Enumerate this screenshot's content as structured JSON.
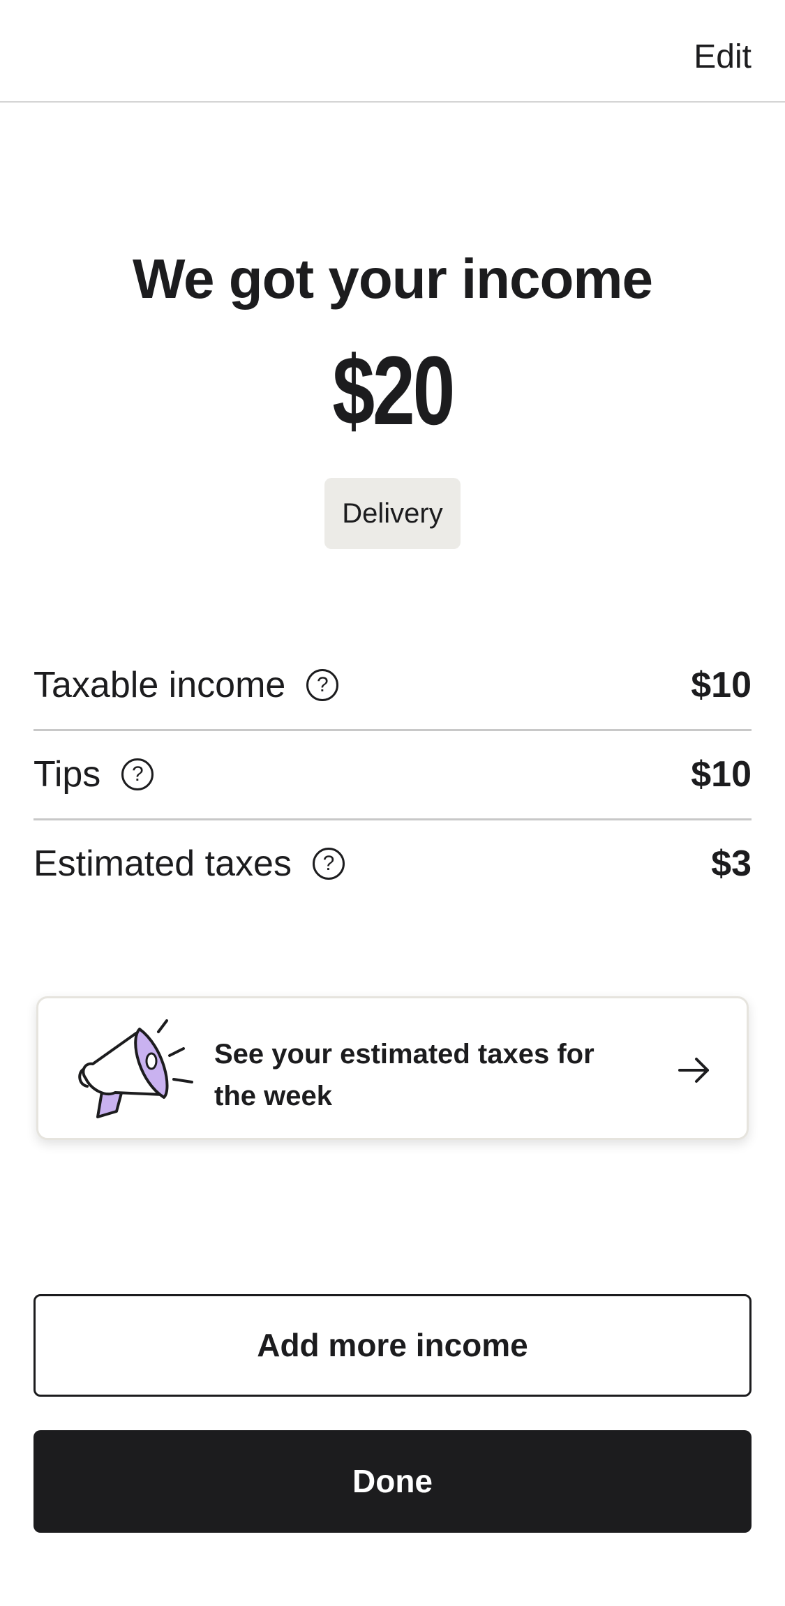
{
  "header": {
    "edit_label": "Edit"
  },
  "summary": {
    "title": "We got your income",
    "amount": "$20",
    "category": "Delivery"
  },
  "breakdown": [
    {
      "label": "Taxable income",
      "value": "$10"
    },
    {
      "label": "Tips",
      "value": "$10"
    },
    {
      "label": "Estimated taxes",
      "value": "$3"
    }
  ],
  "promo": {
    "text": "See your estimated taxes for the week",
    "icon": "megaphone-icon",
    "arrow_icon": "arrow-right-icon",
    "accent_color": "#c9b2f0"
  },
  "actions": {
    "add_more_label": "Add more income",
    "done_label": "Done"
  },
  "colors": {
    "text": "#1c1c1e",
    "chip_background": "#ecebe7",
    "primary_button": "#1c1c1e"
  }
}
